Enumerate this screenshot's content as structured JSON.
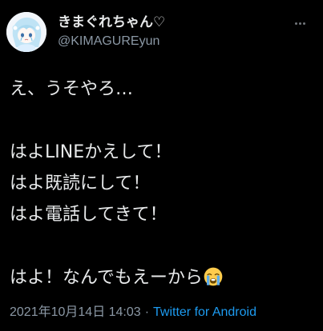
{
  "tweet": {
    "author": {
      "display_name": "きまぐれちゃん♡",
      "handle": "@KIMAGUREyun",
      "avatar_icon": "avatar-illustration"
    },
    "lines": [
      "え、うそやろ…",
      "",
      "はよLINEかえして！",
      "はよ既読にして！",
      "はよ電話してきて！",
      "",
      "はよ！なんでもえーから"
    ],
    "trailing_emoji": "loudly-crying-face-icon",
    "timestamp": "2021年10月14日 14:03",
    "separator": "·",
    "source": "Twitter for Android"
  },
  "colors": {
    "background": "#000000",
    "text": "#e7e9ea",
    "secondary": "#8b98a5",
    "link": "#1d9bf0"
  }
}
